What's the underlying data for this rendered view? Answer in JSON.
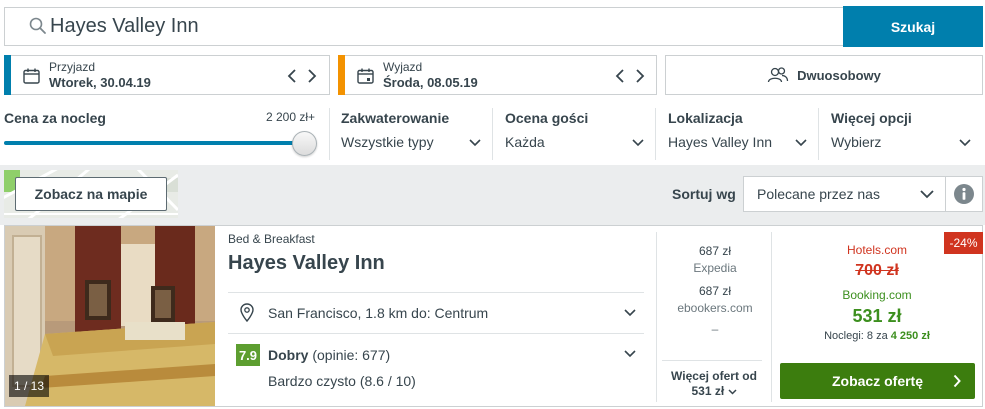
{
  "search": {
    "query": "Hayes Valley Inn",
    "button_label": "Szukaj"
  },
  "dates": {
    "checkin": {
      "label": "Przyjazd",
      "value": "Wtorek, 30.04.19"
    },
    "checkout": {
      "label": "Wyjazd",
      "value": "Środa, 08.05.19"
    }
  },
  "room": {
    "label": "Dwuosobowy"
  },
  "filters": {
    "price": {
      "title": "Cena za nocleg",
      "max_label": "2 200 zł+",
      "level_fraction": 1.0
    },
    "accommodation": {
      "title": "Zakwaterowanie",
      "value": "Wszystkie typy"
    },
    "rating": {
      "title": "Ocena gości",
      "value": "Każda"
    },
    "location": {
      "title": "Lokalizacja",
      "value": "Hayes Valley Inn"
    },
    "more": {
      "title": "Więcej opcji",
      "value": "Wybierz"
    }
  },
  "toolbar": {
    "map_button": "Zobacz na mapie",
    "sort_label": "Sortuj wg",
    "sort_value": "Polecane przez nas"
  },
  "result": {
    "photo_counter": "1 / 13",
    "type": "Bed & Breakfast",
    "name": "Hayes Valley Inn",
    "location": "San Francisco, 1.8 km do: Centrum",
    "rating_score": "7.9",
    "rating_word": "Dobry",
    "rating_count": "(opinie: 677)",
    "rating_detail": "Bardzo czysto (8.6 / 10)",
    "offers": [
      {
        "price": "687 zł",
        "provider": "Expedia"
      },
      {
        "price": "687 zł",
        "provider": "ebookers.com"
      }
    ],
    "offers_placeholder": "–",
    "more_offers_label": "Więcej ofert od",
    "more_offers_price": "531 zł",
    "discount": "-24%",
    "deal": {
      "provider_old": "Hotels.com",
      "old_price": "700 zł",
      "provider": "Booking.com",
      "price": "531 zł",
      "nights_text": "Noclegi: 8 za",
      "total": "4 250 zł"
    },
    "cta_label": "Zobacz ofertę"
  },
  "colors": {
    "accent": "#007fad",
    "checkin_bar": "#007fad",
    "checkout_bar": "#f39200",
    "rating_green": "#5d9e30",
    "cta_green": "#3c7d0e",
    "discount_red": "#d0341f"
  }
}
